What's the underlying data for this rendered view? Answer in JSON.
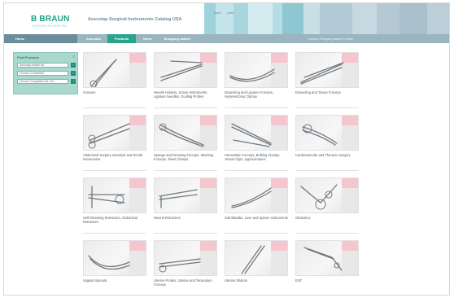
{
  "header": {
    "brand": "B BRAUN",
    "tagline": "SHARING EXPERTISE",
    "title": "Aesculap Surgical Instruments Catalog USA",
    "links": [
      "back",
      "print"
    ],
    "banner_colors": [
      "#9fd3dc",
      "#c2e4ea",
      "#a8d6df",
      "#d4ecf0",
      "#b6dde4",
      "#8ec7d2",
      "#c9dfe6",
      "#b3cbd6",
      "#c6d8e0",
      "#b4c9d3",
      "#a9c0cc",
      "#bccfd8"
    ]
  },
  "nav": {
    "home": "Home",
    "items": [
      "Aesculap",
      "Products",
      "News",
      "Shopping basket"
    ],
    "active_item": "Products",
    "right_text": "Contact | Shopping basket: 0 Article"
  },
  "finder": {
    "title": "Find Products",
    "close": "x",
    "fields": [
      "Aesculap Article No",
      "Choose Competitor",
      "Choose Competitor Art. No"
    ],
    "go": "›"
  },
  "categories": [
    {
      "label": "Scissors",
      "icon": "scissors"
    },
    {
      "label": "Needle Holders, Suture Instruments, Ligature Needles, Guiding Probes",
      "icon": "needle-holder"
    },
    {
      "label": "Dissecting and Ligature Forceps, Hysterectomy Clamps",
      "icon": "ligature-forceps"
    },
    {
      "label": "Dissecting and Tissue Forceps",
      "icon": "tissue-forceps"
    },
    {
      "label": "Abdominal Surgery Intestinal and Rectal Instruments",
      "icon": "intestinal-clamp"
    },
    {
      "label": "Sponge and Dressing Forceps, Washing Forceps, Towel Clamps",
      "icon": "sponge-forceps"
    },
    {
      "label": "Hemostatic Forceps, Bulldog Clamps, Vessel Clips, Approximators",
      "icon": "hemostatic-forceps"
    },
    {
      "label": "Cardiovascular and Thoracic Surgery",
      "icon": "cardiovascular"
    },
    {
      "label": "Self Retaining Retractors, Abdominal Retractors",
      "icon": "self-retaining-retractor"
    },
    {
      "label": "Wound Retractors",
      "icon": "wound-retractor"
    },
    {
      "label": "Gall Bladder, Liver and Spleen Instruments",
      "icon": "gall-bladder"
    },
    {
      "label": "Obstetrics",
      "icon": "obstetrics"
    },
    {
      "label": "Vaginal Specula",
      "icon": "vaginal-specula"
    },
    {
      "label": "Uterine Probes, Uterine and Tenaculum Forceps",
      "icon": "uterine-forceps"
    },
    {
      "label": "Uterine Dilators",
      "icon": "uterine-dilator"
    },
    {
      "label": "ENT",
      "icon": "ent"
    }
  ]
}
